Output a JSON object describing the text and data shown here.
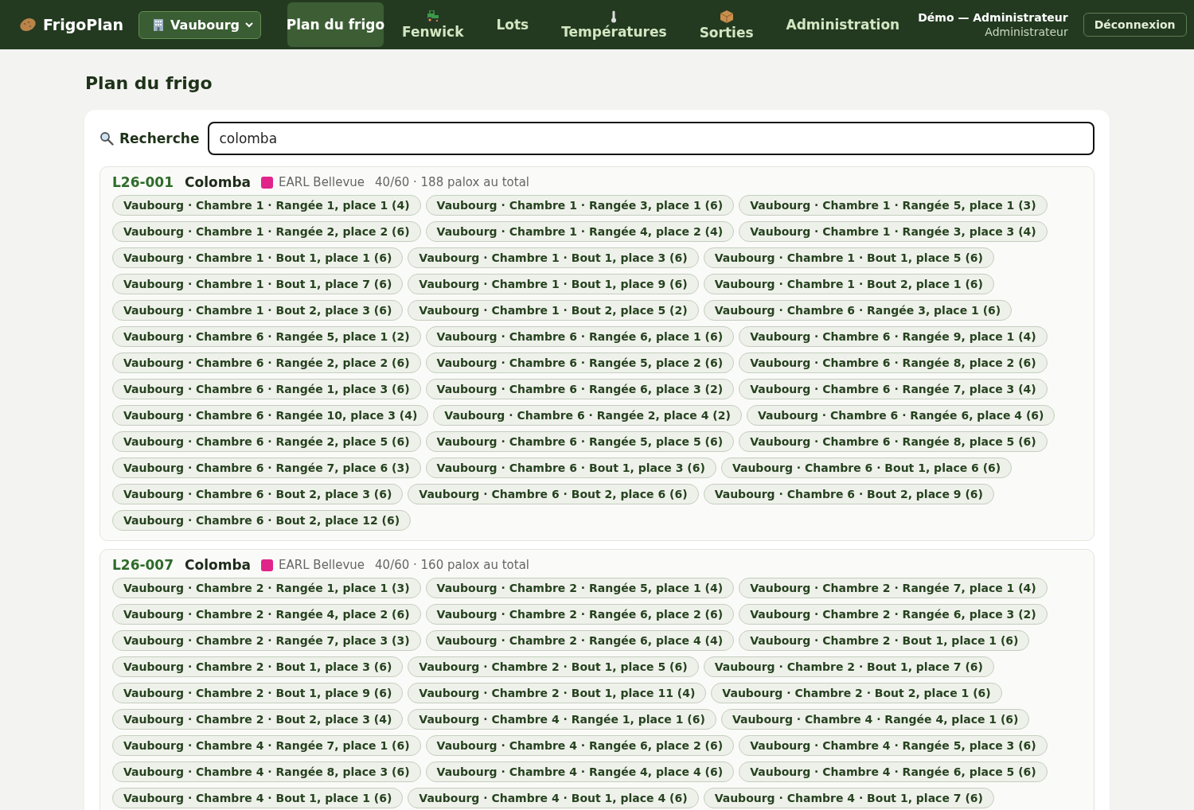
{
  "app": {
    "name": "FrigoPlan"
  },
  "site_select": {
    "value": "Vaubourg"
  },
  "nav": [
    {
      "label": "Plan du frigo",
      "selected": true,
      "kind": "text"
    },
    {
      "label": "Fenwick",
      "selected": false,
      "kind": "icon"
    },
    {
      "label": "Lots",
      "selected": false,
      "kind": "text"
    },
    {
      "label": "Températures",
      "selected": false,
      "kind": "icon"
    },
    {
      "label": "Sorties",
      "selected": false,
      "kind": "icon"
    },
    {
      "label": "Administration",
      "selected": false,
      "kind": "text"
    }
  ],
  "user": {
    "name": "Démo — Administrateur",
    "role": "Administrateur"
  },
  "logout": "Déconnexion",
  "page_title": "Plan du frigo",
  "search": {
    "label": "Recherche",
    "value": "colomba"
  },
  "lots": [
    {
      "code": "L26-001",
      "variety": "Colomba",
      "color": "#e0248a",
      "grower": "EARL Bellevue",
      "stock": "40/60 · 188 palox au total",
      "places": [
        "Vaubourg · Chambre 1 · Rangée 1, place 1 (4)",
        "Vaubourg · Chambre 1 · Rangée 3, place 1 (6)",
        "Vaubourg · Chambre 1 · Rangée 5, place 1 (3)",
        "Vaubourg · Chambre 1 · Rangée 2, place 2 (6)",
        "Vaubourg · Chambre 1 · Rangée 4, place 2 (4)",
        "Vaubourg · Chambre 1 · Rangée 3, place 3 (4)",
        "Vaubourg · Chambre 1 · Bout 1, place 1 (6)",
        "Vaubourg · Chambre 1 · Bout 1, place 3 (6)",
        "Vaubourg · Chambre 1 · Bout 1, place 5 (6)",
        "Vaubourg · Chambre 1 · Bout 1, place 7 (6)",
        "Vaubourg · Chambre 1 · Bout 1, place 9 (6)",
        "Vaubourg · Chambre 1 · Bout 2, place 1 (6)",
        "Vaubourg · Chambre 1 · Bout 2, place 3 (6)",
        "Vaubourg · Chambre 1 · Bout 2, place 5 (2)",
        "Vaubourg · Chambre 6 · Rangée 3, place 1 (6)",
        "Vaubourg · Chambre 6 · Rangée 5, place 1 (2)",
        "Vaubourg · Chambre 6 · Rangée 6, place 1 (6)",
        "Vaubourg · Chambre 6 · Rangée 9, place 1 (4)",
        "Vaubourg · Chambre 6 · Rangée 2, place 2 (6)",
        "Vaubourg · Chambre 6 · Rangée 5, place 2 (6)",
        "Vaubourg · Chambre 6 · Rangée 8, place 2 (6)",
        "Vaubourg · Chambre 6 · Rangée 1, place 3 (6)",
        "Vaubourg · Chambre 6 · Rangée 6, place 3 (2)",
        "Vaubourg · Chambre 6 · Rangée 7, place 3 (4)",
        "Vaubourg · Chambre 6 · Rangée 10, place 3 (4)",
        "Vaubourg · Chambre 6 · Rangée 2, place 4 (2)",
        "Vaubourg · Chambre 6 · Rangée 6, place 4 (6)",
        "Vaubourg · Chambre 6 · Rangée 2, place 5 (6)",
        "Vaubourg · Chambre 6 · Rangée 5, place 5 (6)",
        "Vaubourg · Chambre 6 · Rangée 8, place 5 (6)",
        "Vaubourg · Chambre 6 · Rangée 7, place 6 (3)",
        "Vaubourg · Chambre 6 · Bout 1, place 3 (6)",
        "Vaubourg · Chambre 6 · Bout 1, place 6 (6)",
        "Vaubourg · Chambre 6 · Bout 2, place 3 (6)",
        "Vaubourg · Chambre 6 · Bout 2, place 6 (6)",
        "Vaubourg · Chambre 6 · Bout 2, place 9 (6)",
        "Vaubourg · Chambre 6 · Bout 2, place 12 (6)"
      ]
    },
    {
      "code": "L26-007",
      "variety": "Colomba",
      "color": "#e0248a",
      "grower": "EARL Bellevue",
      "stock": "40/60 · 160 palox au total",
      "places": [
        "Vaubourg · Chambre 2 · Rangée 1, place 1 (3)",
        "Vaubourg · Chambre 2 · Rangée 5, place 1 (4)",
        "Vaubourg · Chambre 2 · Rangée 7, place 1 (4)",
        "Vaubourg · Chambre 2 · Rangée 4, place 2 (6)",
        "Vaubourg · Chambre 2 · Rangée 6, place 2 (6)",
        "Vaubourg · Chambre 2 · Rangée 6, place 3 (2)",
        "Vaubourg · Chambre 2 · Rangée 7, place 3 (3)",
        "Vaubourg · Chambre 2 · Rangée 6, place 4 (4)",
        "Vaubourg · Chambre 2 · Bout 1, place 1 (6)",
        "Vaubourg · Chambre 2 · Bout 1, place 3 (6)",
        "Vaubourg · Chambre 2 · Bout 1, place 5 (6)",
        "Vaubourg · Chambre 2 · Bout 1, place 7 (6)",
        "Vaubourg · Chambre 2 · Bout 1, place 9 (6)",
        "Vaubourg · Chambre 2 · Bout 1, place 11 (4)",
        "Vaubourg · Chambre 2 · Bout 2, place 1 (6)",
        "Vaubourg · Chambre 2 · Bout 2, place 3 (4)",
        "Vaubourg · Chambre 4 · Rangée 1, place 1 (6)",
        "Vaubourg · Chambre 4 · Rangée 4, place 1 (6)",
        "Vaubourg · Chambre 4 · Rangée 7, place 1 (6)",
        "Vaubourg · Chambre 4 · Rangée 6, place 2 (6)",
        "Vaubourg · Chambre 4 · Rangée 5, place 3 (6)",
        "Vaubourg · Chambre 4 · Rangée 8, place 3 (6)",
        "Vaubourg · Chambre 4 · Rangée 4, place 4 (6)",
        "Vaubourg · Chambre 4 · Rangée 6, place 5 (6)",
        "Vaubourg · Chambre 4 · Bout 1, place 1 (6)",
        "Vaubourg · Chambre 4 · Bout 1, place 4 (6)",
        "Vaubourg · Chambre 4 · Bout 1, place 7 (6)"
      ]
    }
  ]
}
